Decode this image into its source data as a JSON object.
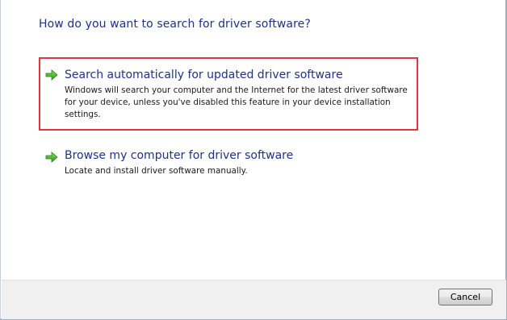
{
  "dialog": {
    "heading": "How do you want to search for driver software?"
  },
  "options": [
    {
      "title": "Search automatically for updated driver software",
      "description_lines": [
        "Windows will search your computer and the Internet for the latest driver software",
        "for your device, unless you've disabled this feature in your device installation",
        "settings."
      ],
      "icon": "green-arrow-icon"
    },
    {
      "title": "Browse my computer for driver software",
      "description_lines": [
        "Locate and install driver software manually."
      ],
      "icon": "green-arrow-icon"
    }
  ],
  "footer": {
    "cancel_label": "Cancel"
  },
  "colors": {
    "title_text": "#1e3287",
    "highlight_border": "#e0373f",
    "arrow_green": "#3fae2a"
  }
}
